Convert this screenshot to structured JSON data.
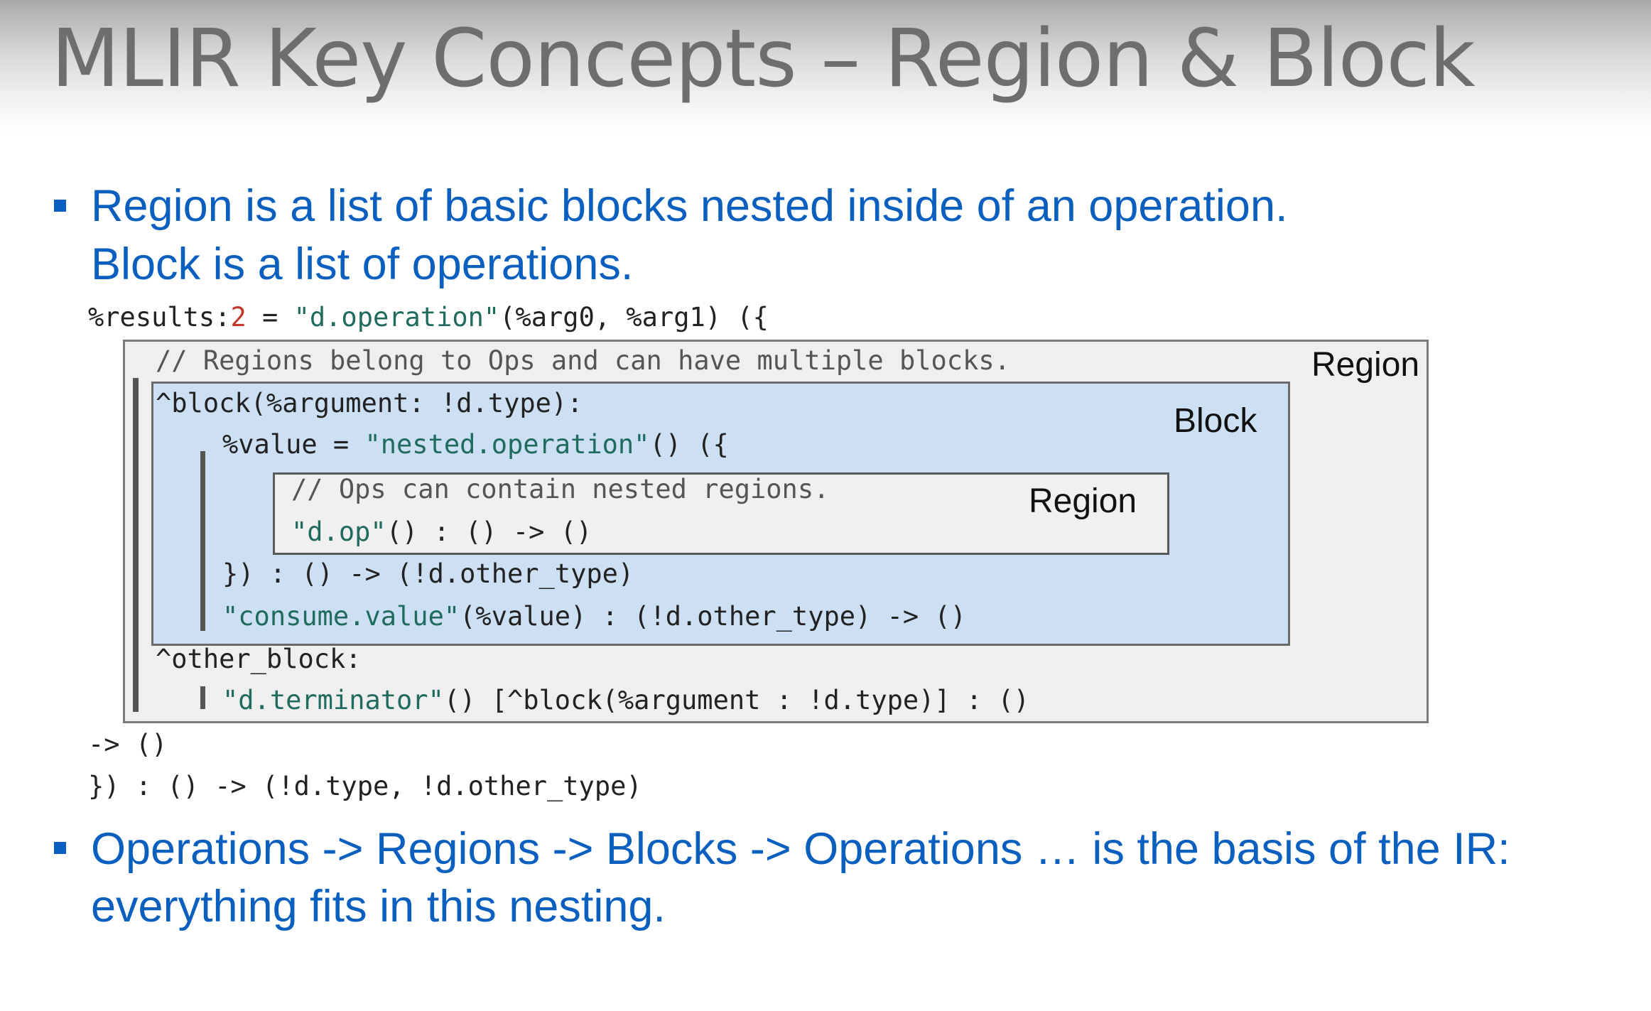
{
  "slide": {
    "title": "MLIR Key Concepts – Region & Block",
    "bullets": [
      {
        "line1_keyword": "Region",
        "line1_rest": " is a list of basic blocks nested inside of an operation.",
        "line2_keyword": "Block",
        "line2_rest": " is a list of operations."
      },
      {
        "line1": "Operations -> Regions -> Blocks -> Operations … is the basis of the IR:",
        "line2": "everything fits in this nesting."
      }
    ],
    "code": {
      "l1_a": "%results:",
      "l1_num": "2",
      "l1_b": " = ",
      "l1_str": "\"d.operation\"",
      "l1_c": "(%arg0, %arg1) ({",
      "l2_comment": "// Regions belong to Ops and can have multiple blocks.",
      "l3": "^block(%argument: !d.type):",
      "l4_a": "%value = ",
      "l4_str": "\"nested.operation\"",
      "l4_b": "() ({",
      "l5_comment": "// Ops can contain nested regions.",
      "l6_str": "\"d.op\"",
      "l6_b": "() : () -> ()",
      "l7": "}) : () -> (!d.other_type)",
      "l8_str": "\"consume.value\"",
      "l8_b": "(%value) : (!d.other_type) -> ()",
      "l9": "^other_block:",
      "l10_str": "\"d.terminator\"",
      "l10_b": "() [^block(%argument : !d.type)] : ()",
      "l11": "-> ()",
      "l12": "}) : () -> (!d.type, !d.other_type)"
    },
    "labels": {
      "outer_region": "Region",
      "block": "Block",
      "inner_region": "Region"
    }
  }
}
